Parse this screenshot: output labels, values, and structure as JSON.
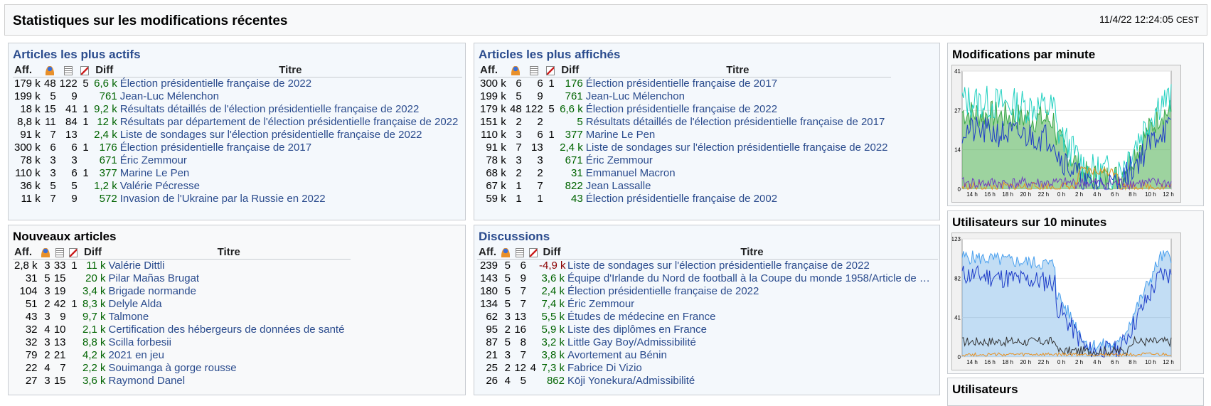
{
  "header": {
    "title": "Statistiques sur les modifications récentes",
    "time": "11/4/22 12:24:05",
    "tz": "CEST"
  },
  "columns": {
    "aff": "Aff.",
    "diff": "Diff",
    "titre": "Titre"
  },
  "active": {
    "title": "Articles les plus actifs",
    "rows": [
      {
        "aff": "179 k",
        "users": "48",
        "edits": "122",
        "rev": "5",
        "diff": "6,6 k",
        "title": "Élection présidentielle française de 2022"
      },
      {
        "aff": "199 k",
        "users": "5",
        "edits": "9",
        "rev": "",
        "diff": "761",
        "title": "Jean-Luc Mélenchon"
      },
      {
        "aff": "18 k",
        "users": "15",
        "edits": "41",
        "rev": "1",
        "diff": "9,2 k",
        "title": "Résultats détaillés de l'élection présidentielle française de 2022"
      },
      {
        "aff": "8,8 k",
        "users": "11",
        "edits": "84",
        "rev": "1",
        "diff": "12 k",
        "title": "Résultats par département de l'élection présidentielle française de 2022"
      },
      {
        "aff": "91 k",
        "users": "7",
        "edits": "13",
        "rev": "",
        "diff": "2,4 k",
        "title": "Liste de sondages sur l'élection présidentielle française de 2022"
      },
      {
        "aff": "300 k",
        "users": "6",
        "edits": "6",
        "rev": "1",
        "diff": "176",
        "title": "Élection présidentielle française de 2017"
      },
      {
        "aff": "78 k",
        "users": "3",
        "edits": "3",
        "rev": "",
        "diff": "671",
        "title": "Éric Zemmour"
      },
      {
        "aff": "110 k",
        "users": "3",
        "edits": "6",
        "rev": "1",
        "diff": "377",
        "title": "Marine Le Pen"
      },
      {
        "aff": "36 k",
        "users": "5",
        "edits": "5",
        "rev": "",
        "diff": "1,2 k",
        "title": "Valérie Pécresse"
      },
      {
        "aff": "11 k",
        "users": "7",
        "edits": "9",
        "rev": "",
        "diff": "572",
        "title": "Invasion de l'Ukraine par la Russie en 2022"
      }
    ]
  },
  "viewed": {
    "title": "Articles les plus affichés",
    "rows": [
      {
        "aff": "300 k",
        "users": "6",
        "edits": "6",
        "rev": "1",
        "diff": "176",
        "title": "Élection présidentielle française de 2017"
      },
      {
        "aff": "199 k",
        "users": "5",
        "edits": "9",
        "rev": "",
        "diff": "761",
        "title": "Jean-Luc Mélenchon"
      },
      {
        "aff": "179 k",
        "users": "48",
        "edits": "122",
        "rev": "5",
        "diff": "6,6 k",
        "title": "Élection présidentielle française de 2022"
      },
      {
        "aff": "151 k",
        "users": "2",
        "edits": "2",
        "rev": "",
        "diff": "5",
        "title": "Résultats détaillés de l'élection présidentielle française de 2017"
      },
      {
        "aff": "110 k",
        "users": "3",
        "edits": "6",
        "rev": "1",
        "diff": "377",
        "title": "Marine Le Pen"
      },
      {
        "aff": "91 k",
        "users": "7",
        "edits": "13",
        "rev": "",
        "diff": "2,4 k",
        "title": "Liste de sondages sur l'élection présidentielle française de 2022"
      },
      {
        "aff": "78 k",
        "users": "3",
        "edits": "3",
        "rev": "",
        "diff": "671",
        "title": "Éric Zemmour"
      },
      {
        "aff": "68 k",
        "users": "2",
        "edits": "2",
        "rev": "",
        "diff": "31",
        "title": "Emmanuel Macron"
      },
      {
        "aff": "67 k",
        "users": "1",
        "edits": "7",
        "rev": "",
        "diff": "822",
        "title": "Jean Lassalle"
      },
      {
        "aff": "59 k",
        "users": "1",
        "edits": "1",
        "rev": "",
        "diff": "43",
        "title": "Élection présidentielle française de 2002"
      }
    ]
  },
  "new": {
    "title": "Nouveaux articles",
    "rows": [
      {
        "aff": "2,8 k",
        "users": "3",
        "edits": "33",
        "rev": "1",
        "diff": "11 k",
        "title": "Valérie Dittli"
      },
      {
        "aff": "31",
        "users": "5",
        "edits": "15",
        "rev": "",
        "diff": "20 k",
        "title": "Pilar Mañas Brugat"
      },
      {
        "aff": "104",
        "users": "3",
        "edits": "19",
        "rev": "",
        "diff": "3,4 k",
        "title": "Brigade normande"
      },
      {
        "aff": "51",
        "users": "2",
        "edits": "42",
        "rev": "1",
        "diff": "8,3 k",
        "title": "Delyle Alda"
      },
      {
        "aff": "43",
        "users": "3",
        "edits": "9",
        "rev": "",
        "diff": "9,7 k",
        "title": "Talmone"
      },
      {
        "aff": "32",
        "users": "4",
        "edits": "10",
        "rev": "",
        "diff": "2,1 k",
        "title": "Certification des hébergeurs de données de santé"
      },
      {
        "aff": "32",
        "users": "3",
        "edits": "13",
        "rev": "",
        "diff": "8,8 k",
        "title": "Scilla forbesii"
      },
      {
        "aff": "79",
        "users": "2",
        "edits": "21",
        "rev": "",
        "diff": "4,2 k",
        "title": "2021 en jeu"
      },
      {
        "aff": "22",
        "users": "4",
        "edits": "7",
        "rev": "",
        "diff": "2,2 k",
        "title": "Souimanga à gorge rousse"
      },
      {
        "aff": "27",
        "users": "3",
        "edits": "15",
        "rev": "",
        "diff": "3,6 k",
        "title": "Raymond Danel"
      }
    ]
  },
  "discussions": {
    "title": "Discussions",
    "rows": [
      {
        "aff": "239",
        "users": "5",
        "edits": "6",
        "rev": "",
        "diff": "-4,9 k",
        "neg": true,
        "title": "Liste de sondages sur l'élection présidentielle française de 2022"
      },
      {
        "aff": "143",
        "users": "5",
        "edits": "9",
        "rev": "",
        "diff": "3,6 k",
        "title": "Équipe d'Irlande du Nord de football à la Coupe du monde 1958/Article de …"
      },
      {
        "aff": "180",
        "users": "5",
        "edits": "7",
        "rev": "",
        "diff": "2,4 k",
        "title": "Élection présidentielle française de 2022"
      },
      {
        "aff": "134",
        "users": "5",
        "edits": "7",
        "rev": "",
        "diff": "7,4 k",
        "title": "Éric Zemmour"
      },
      {
        "aff": "62",
        "users": "3",
        "edits": "13",
        "rev": "",
        "diff": "5,5 k",
        "title": "Études de médecine en France"
      },
      {
        "aff": "95",
        "users": "2",
        "edits": "16",
        "rev": "",
        "diff": "5,9 k",
        "title": "Liste des diplômes en France"
      },
      {
        "aff": "87",
        "users": "5",
        "edits": "8",
        "rev": "",
        "diff": "3,2 k",
        "title": "Little Gay Boy/Admissibilité"
      },
      {
        "aff": "21",
        "users": "3",
        "edits": "7",
        "rev": "",
        "diff": "3,8 k",
        "title": "Avortement au Bénin"
      },
      {
        "aff": "25",
        "users": "2",
        "edits": "12",
        "rev": "4",
        "diff": "7,3 k",
        "title": "Fabrice Di Vizio"
      },
      {
        "aff": "26",
        "users": "4",
        "edits": "5",
        "rev": "",
        "diff": "862",
        "title": "Kōji Yonekura/Admissibilité"
      }
    ]
  },
  "chart1": {
    "title": "Modifications par minute",
    "yticks": [
      "41",
      "27",
      "14",
      "0"
    ],
    "xticks": [
      "14 h",
      "16 h",
      "18 h",
      "20 h",
      "22 h",
      "0 h",
      "2 h",
      "4 h",
      "6 h",
      "8 h",
      "10 h",
      "12 h"
    ]
  },
  "chart2": {
    "title": "Utilisateurs sur 10 minutes",
    "yticks": [
      "123",
      "82",
      "41",
      "0"
    ],
    "xticks": [
      "14 h",
      "16 h",
      "18 h",
      "20 h",
      "22 h",
      "0 h",
      "2 h",
      "4 h",
      "6 h",
      "8 h",
      "10 h",
      "12 h"
    ]
  },
  "chart3": {
    "title": "Utilisateurs"
  },
  "colors": {
    "link": "#2a4b8d",
    "diff_pos": "#006400",
    "diff_neg": "#8b0000",
    "edits_green": "#4caf50",
    "users_blue": "#1e3cc8",
    "cyan": "#20d0c0",
    "orange": "#e89020"
  }
}
